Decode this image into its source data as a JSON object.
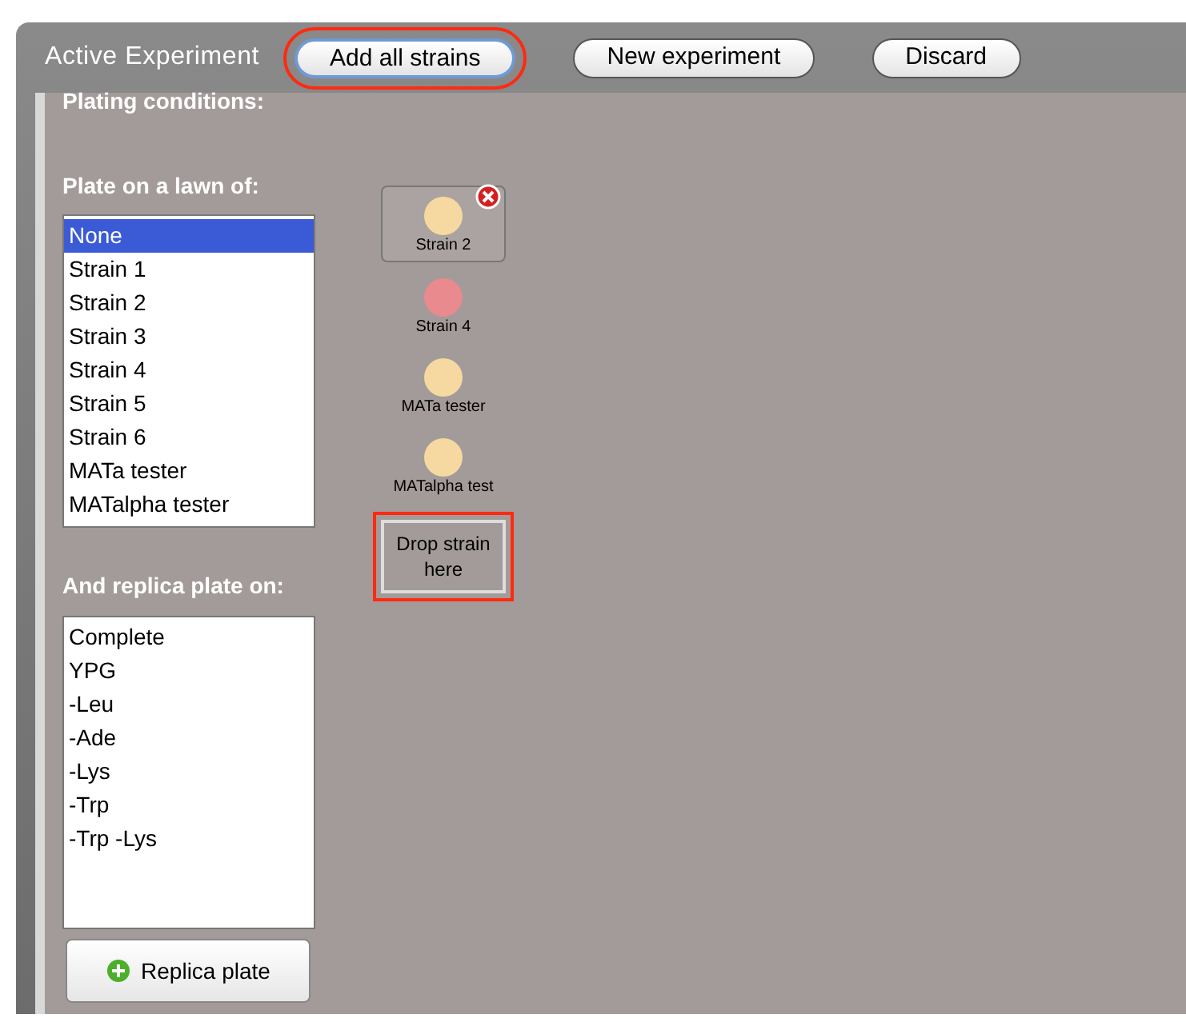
{
  "header": {
    "title": "Active Experiment",
    "buttons": [
      {
        "label": "Add all strains",
        "highlighted": true,
        "focused": true
      },
      {
        "label": "New experiment",
        "highlighted": false,
        "focused": false
      },
      {
        "label": "Discard",
        "highlighted": false,
        "focused": false
      }
    ]
  },
  "section_title": "Plating conditions:",
  "lawn": {
    "label": "Plate on a lawn of:",
    "items": [
      {
        "label": "None",
        "selected": true
      },
      {
        "label": "Strain 1",
        "selected": false
      },
      {
        "label": "Strain 2",
        "selected": false
      },
      {
        "label": "Strain 3",
        "selected": false
      },
      {
        "label": "Strain 4",
        "selected": false
      },
      {
        "label": "Strain 5",
        "selected": false
      },
      {
        "label": "Strain 6",
        "selected": false
      },
      {
        "label": "MATa tester",
        "selected": false
      },
      {
        "label": "MATalpha tester",
        "selected": false
      }
    ]
  },
  "replica": {
    "label": "And replica plate on:",
    "items": [
      {
        "label": "Complete",
        "selected": false
      },
      {
        "label": "YPG",
        "selected": false
      },
      {
        "label": "-Leu",
        "selected": false
      },
      {
        "label": "-Ade",
        "selected": false
      },
      {
        "label": "-Lys",
        "selected": false
      },
      {
        "label": "-Trp",
        "selected": false
      },
      {
        "label": "-Trp -Lys",
        "selected": false
      }
    ],
    "button": "Replica plate"
  },
  "strains": [
    {
      "label": "Strain 2",
      "color": "#f6d9a0",
      "selected": true
    },
    {
      "label": "Strain 4",
      "color": "#e88a8e",
      "selected": false
    },
    {
      "label": "MATa tester",
      "color": "#f6d9a0",
      "selected": false
    },
    {
      "label": "MATalpha test",
      "color": "#f6d9a0",
      "selected": false
    }
  ],
  "drop_zone": {
    "label": "Drop strain here",
    "highlighted": true
  }
}
